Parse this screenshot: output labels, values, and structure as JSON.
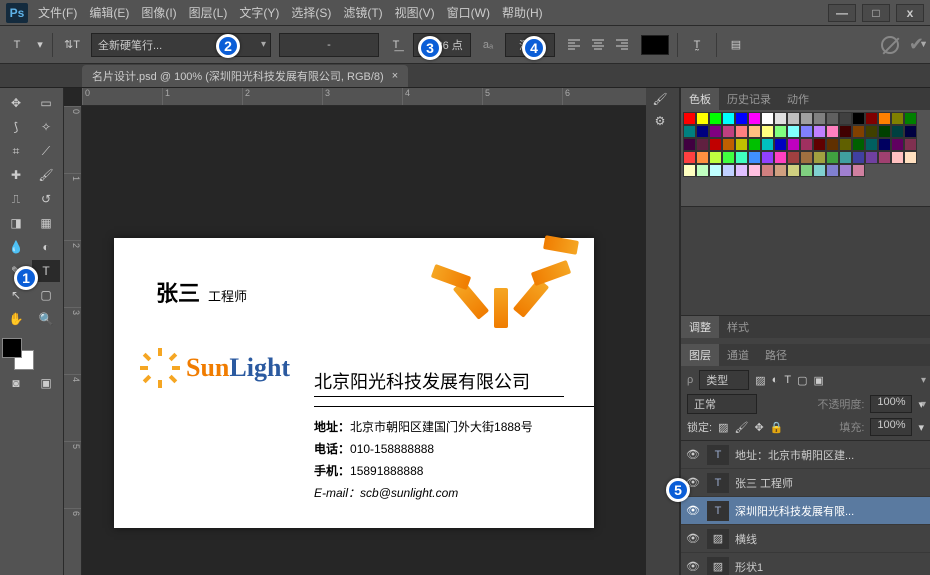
{
  "app": {
    "logo": "Ps"
  },
  "menu": [
    "文件(F)",
    "编辑(E)",
    "图像(I)",
    "图层(L)",
    "文字(Y)",
    "选择(S)",
    "滤镜(T)",
    "视图(V)",
    "窗口(W)",
    "帮助(H)"
  ],
  "window_controls": {
    "min": "—",
    "max": "□",
    "close": "x"
  },
  "options": {
    "font_family": "全新硬笔行...",
    "font_style": "-",
    "size": "10.36 点",
    "aa_glyph": "aₐ",
    "aa": "浑厚",
    "check": "✔"
  },
  "doc_tab": {
    "label": "名片设计.psd @ 100% (深圳阳光科技发展有限公司, RGB/8)",
    "close": "×"
  },
  "ruler_h": [
    "0",
    "1",
    "2",
    "3",
    "4",
    "5",
    "6"
  ],
  "ruler_v": [
    "0",
    "1",
    "2",
    "3",
    "4",
    "5",
    "6"
  ],
  "card": {
    "name": "张三",
    "title": "工程师",
    "logo1": "Sun",
    "logo2": "Light",
    "company": "北京阳光科技发展有限公司",
    "addr_label": "地址：",
    "addr": "北京市朝阳区建国门外大街1888号",
    "tel_label": "电话：",
    "tel": "010-158888888",
    "mob_label": "手机：",
    "mob": "15891888888",
    "email_label": "E-mail：",
    "email": "scb@sunlight.com"
  },
  "panels": {
    "swatch_tabs": [
      "色板",
      "历史记录",
      "动作"
    ],
    "adjust_tabs": [
      "调整",
      "样式"
    ],
    "layer_tabs": [
      "图层",
      "通道",
      "路径"
    ],
    "kind_label": "类型",
    "blend_mode": "正常",
    "opacity_label": "不透明度:",
    "opacity": "100%",
    "lock_label": "锁定:",
    "fill_label": "填充:",
    "fill": "100%"
  },
  "layers": [
    {
      "type": "T",
      "name": "地址：北京市朝阳区建..."
    },
    {
      "type": "T",
      "name": "张三  工程师"
    },
    {
      "type": "T",
      "name": "深圳阳光科技发展有限..."
    },
    {
      "type": "S",
      "name": "横线"
    },
    {
      "type": "S",
      "name": "形状1"
    }
  ],
  "swatch_colors": [
    "#ff0000",
    "#ffff00",
    "#00ff00",
    "#00ffff",
    "#0000ff",
    "#ff00ff",
    "#ffffff",
    "#e0e0e0",
    "#c0c0c0",
    "#a0a0a0",
    "#808080",
    "#606060",
    "#404040",
    "#000000",
    "#800000",
    "#ff8000",
    "#808000",
    "#008000",
    "#008080",
    "#000080",
    "#800080",
    "#c04080",
    "#ff8080",
    "#ffc080",
    "#ffff80",
    "#80ff80",
    "#80ffff",
    "#8080ff",
    "#c080ff",
    "#ff80c0",
    "#400000",
    "#804000",
    "#404000",
    "#004000",
    "#004040",
    "#000040",
    "#400040",
    "#602040",
    "#c00000",
    "#c06000",
    "#c0c000",
    "#00c000",
    "#00c0c0",
    "#0000c0",
    "#c000c0",
    "#a03060",
    "#600000",
    "#603000",
    "#606000",
    "#006000",
    "#006060",
    "#000060",
    "#600060",
    "#803050",
    "#ff4040",
    "#ff9040",
    "#c0ff40",
    "#40ff40",
    "#40ffc0",
    "#4090ff",
    "#9040ff",
    "#ff40c0",
    "#a04040",
    "#a07040",
    "#a0a040",
    "#40a040",
    "#40a0a0",
    "#4040a0",
    "#7040a0",
    "#a04070",
    "#ffc0c0",
    "#ffe0c0",
    "#ffffc0",
    "#c0ffc0",
    "#c0ffff",
    "#c0d0ff",
    "#e0c0ff",
    "#ffc0e0",
    "#d08080",
    "#d0a080",
    "#d0d080",
    "#80d080",
    "#80d0d0",
    "#8080d0",
    "#a080d0",
    "#d080a0"
  ],
  "markers": {
    "m1": "1",
    "m2": "2",
    "m3": "3",
    "m4": "4",
    "m5": "5"
  }
}
